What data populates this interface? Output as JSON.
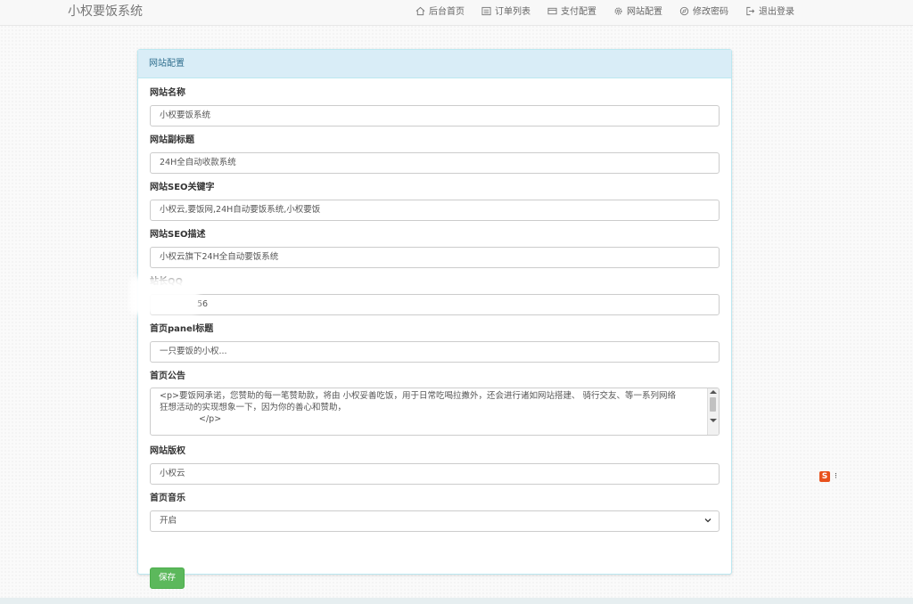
{
  "app": {
    "brand": "小权要饭系统"
  },
  "nav": {
    "items": [
      {
        "label": "后台首页",
        "icon": "home-icon"
      },
      {
        "label": "订单列表",
        "icon": "list-icon"
      },
      {
        "label": "支付配置",
        "icon": "credit-card-icon"
      },
      {
        "label": "网站配置",
        "icon": "gear-icon"
      },
      {
        "label": "修改密码",
        "icon": "compass-icon"
      },
      {
        "label": "退出登录",
        "icon": "logout-icon"
      }
    ]
  },
  "panel": {
    "title": "网站配置"
  },
  "form": {
    "site_name": {
      "label": "网站名称",
      "value": "小权要饭系统"
    },
    "subtitle": {
      "label": "网站副标题",
      "value": "24H全自动收款系统"
    },
    "seo_keywords": {
      "label": "网站SEO关键字",
      "value": "小权云,要饭网,24H自动要饭系统,小权要饭"
    },
    "seo_description": {
      "label": "网站SEO描述",
      "value": "小权云旗下24H全自动要饭系统"
    },
    "qq": {
      "label": "站长QQ",
      "value": "56"
    },
    "panel_title": {
      "label": "首页panel标题",
      "value": "一只要饭的小权..."
    },
    "announcement": {
      "label": "首页公告",
      "line1": "<p>要饭网承诺，您赞助的每一笔赞助款，将由 小权妥善吃饭，用于日常吃喝拉撒外，还会进行诸如网站搭建、 骑行交友、等一系列网络",
      "line2": "狂想活动的实现想象一下，因为你的善心和赞助，",
      "line3": "</p>"
    },
    "copyright": {
      "label": "网站版权",
      "value": "小权云"
    },
    "music": {
      "label": "首页音乐",
      "value": "开启"
    },
    "save_label": "保存"
  },
  "widget": {
    "logo_text": "S"
  }
}
